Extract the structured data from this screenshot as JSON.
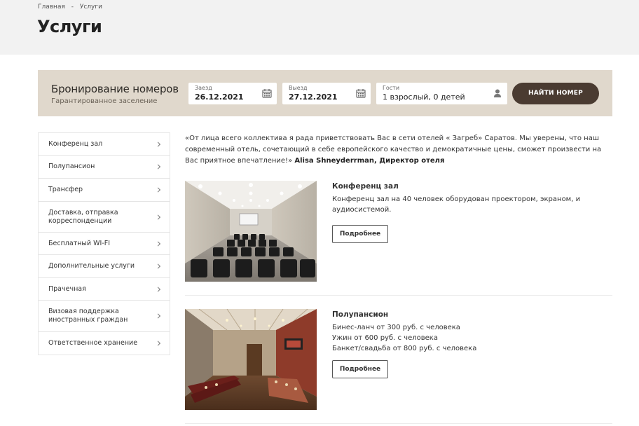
{
  "breadcrumb": {
    "home": "Главная",
    "separator": "-",
    "current": "Услуги"
  },
  "page_title": "Услуги",
  "booking": {
    "title": "Бронирование номеров",
    "subtitle": "Гарантированное заселение",
    "checkin": {
      "label": "Заезд",
      "value": "26.12.2021",
      "icon": "calendar-icon"
    },
    "checkout": {
      "label": "Выезд",
      "value": "27.12.2021",
      "icon": "calendar-icon"
    },
    "guests": {
      "label": "Гости",
      "value": "1 взрослый, 0 детей",
      "icon": "user-icon"
    },
    "find_button": "НАЙТИ НОМЕР",
    "colors": {
      "panel_bg": "#e0d8cc",
      "button_bg": "#4a3b31"
    }
  },
  "sidebar": {
    "items": [
      {
        "line1": "Конференц зал",
        "line2": ""
      },
      {
        "line1": "Полупансион",
        "line2": ""
      },
      {
        "line1": "Трансфер",
        "line2": ""
      },
      {
        "line1": "Доставка, отправка",
        "line2": "корреспонденции"
      },
      {
        "line1": "Бесплатный WI-FI",
        "line2": ""
      },
      {
        "line1": "Дополнительные услуги",
        "line2": ""
      },
      {
        "line1": "Прачечная",
        "line2": ""
      },
      {
        "line1": "Визовая поддержка",
        "line2": "иностранных граждан"
      },
      {
        "line1": "Ответственное хранение",
        "line2": ""
      }
    ]
  },
  "intro": {
    "text": "«От лица всего коллектива я рада приветствовать Вас в сети отелей « Загреб» Саратов.  Мы уверены,  что наш современный отель,  сочетающий в себе европейского качество и демократичные цены,  сможет произвести на Вас приятное впечатление!»",
    "signature": "Alisa Shneyderrman, Директор отеля"
  },
  "services": [
    {
      "title": "Конференц зал",
      "lines": [
        "Конференц зал на 40 человек оборудован проектором, экраном, и аудиосистемой."
      ],
      "button": "Подробнее"
    },
    {
      "title": "Полупансион",
      "lines": [
        "Бинес-ланч от 300 руб. с человека",
        "Ужин от 600 руб. с человека",
        "Банкет/свадьба от 800 руб. с человека"
      ],
      "button": "Подробнее"
    }
  ]
}
